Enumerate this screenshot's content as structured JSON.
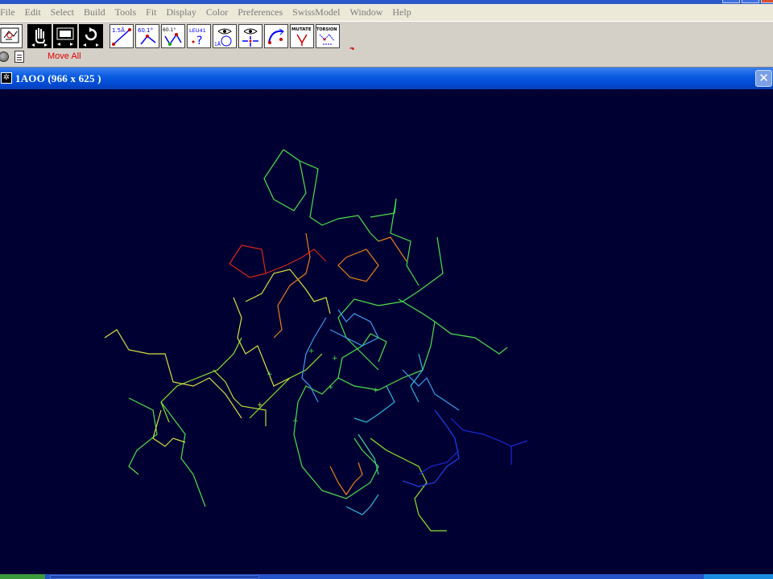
{
  "menu": [
    "File",
    "Edit",
    "Select",
    "Build",
    "Tools",
    "Fit",
    "Display",
    "Color",
    "Preferences",
    "SwissModel",
    "Window",
    "Help"
  ],
  "toolbar": {
    "tools": [
      {
        "name": "center-molecule-tool",
        "label": ""
      },
      {
        "name": "move-all-hand-tool",
        "label": ""
      },
      {
        "name": "translate-tool",
        "label": ""
      },
      {
        "name": "rotate-tool",
        "label": ""
      },
      {
        "name": "measure-distance-tool",
        "label": "1.5Å"
      },
      {
        "name": "measure-angle-tool",
        "label": "60.1°"
      },
      {
        "name": "measure-torsion-tool",
        "label": "60.1°"
      },
      {
        "name": "label-residue-tool",
        "label": "LEU41"
      },
      {
        "name": "show-neighbors-tool",
        "label": "1Å"
      },
      {
        "name": "center-atom-tool",
        "label": ""
      },
      {
        "name": "fit-tool",
        "label": ""
      },
      {
        "name": "mutate-tool",
        "label": "MUTATE"
      },
      {
        "name": "torsion-tool",
        "label": "TORSION"
      }
    ],
    "help_label": "?"
  },
  "status": {
    "text": "Move All"
  },
  "window": {
    "title": "1AOO  (966 x 625 )",
    "close_label": "✕"
  },
  "colors": {
    "background": "#000033",
    "title_blue": "#0a5ce0",
    "status_red": "#e00000"
  }
}
